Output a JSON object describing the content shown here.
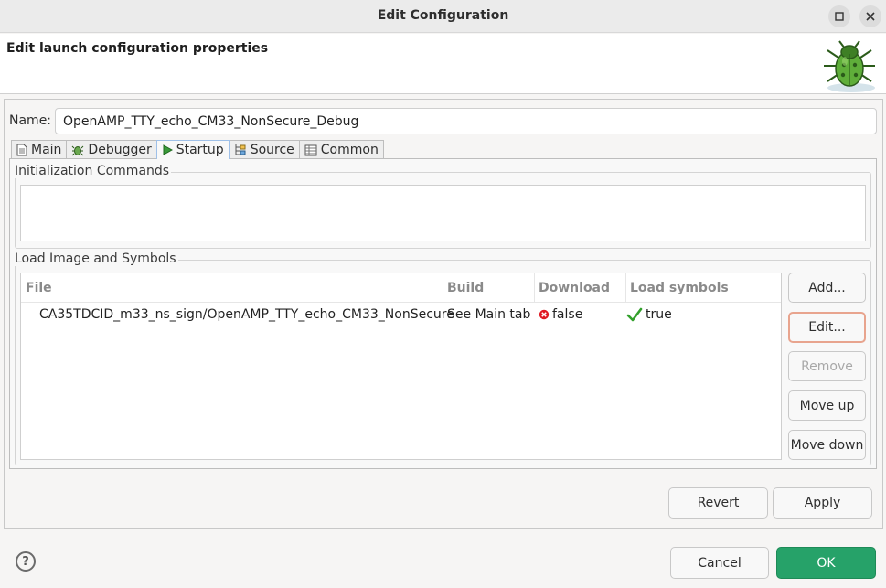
{
  "window": {
    "title": "Edit Configuration"
  },
  "header": {
    "heading": "Edit launch configuration properties"
  },
  "name_field": {
    "label": "Name:",
    "value": "OpenAMP_TTY_echo_CM33_NonSecure_Debug"
  },
  "tabs": [
    {
      "label": "Main",
      "icon": "main-tab-icon"
    },
    {
      "label": "Debugger",
      "icon": "debugger-tab-icon"
    },
    {
      "label": "Startup",
      "icon": "startup-tab-icon",
      "active": true
    },
    {
      "label": "Source",
      "icon": "source-tab-icon"
    },
    {
      "label": "Common",
      "icon": "common-tab-icon"
    }
  ],
  "init_group": {
    "label": "Initialization Commands",
    "text": ""
  },
  "load_group": {
    "label": "Load Image and Symbols",
    "columns": [
      "File",
      "Build",
      "Download",
      "Load symbols"
    ],
    "rows": [
      {
        "file": "CA35TDCID_m33_ns_sign/OpenAMP_TTY_echo_CM33_NonSecure",
        "build": "See Main tab",
        "download": "false",
        "load_symbols": "true"
      }
    ]
  },
  "side_buttons": {
    "add": "Add...",
    "edit": "Edit...",
    "remove": "Remove",
    "move_up": "Move up",
    "move_down": "Move down"
  },
  "buttons": {
    "revert": "Revert",
    "apply": "Apply",
    "cancel": "Cancel",
    "ok": "OK",
    "help": "?"
  },
  "colors": {
    "ok_button": "#26a269",
    "focus_border": "#e8a48e",
    "false_icon": "#e01b24",
    "true_icon": "#33a02c"
  }
}
